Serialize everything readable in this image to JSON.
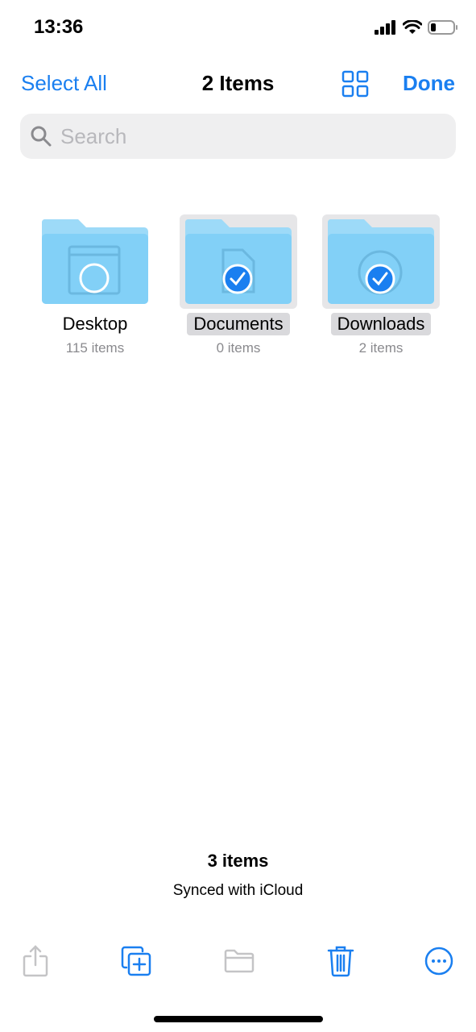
{
  "status_bar": {
    "time": "13:36",
    "icons": [
      "cellular-signal-icon",
      "wifi-icon",
      "battery-icon"
    ]
  },
  "nav": {
    "select_all": "Select All",
    "title": "2 Items",
    "view_toggle_icon": "grid-view-icon",
    "done": "Done"
  },
  "search": {
    "placeholder": "Search",
    "value": ""
  },
  "items": [
    {
      "name": "Desktop",
      "count": "115 items",
      "selected": false,
      "icon": "desktop-folder-icon"
    },
    {
      "name": "Documents",
      "count": "0 items",
      "selected": true,
      "icon": "documents-folder-icon"
    },
    {
      "name": "Downloads",
      "count": "2 items",
      "selected": true,
      "icon": "downloads-folder-icon"
    }
  ],
  "footer": {
    "count": "3 items",
    "sync_status": "Synced with iCloud"
  },
  "toolbar": {
    "buttons": [
      {
        "icon": "share-icon",
        "enabled": false
      },
      {
        "icon": "duplicate-icon",
        "enabled": true
      },
      {
        "icon": "move-folder-icon",
        "enabled": false
      },
      {
        "icon": "trash-icon",
        "enabled": true
      },
      {
        "icon": "more-icon",
        "enabled": true
      }
    ]
  },
  "colors": {
    "accent": "#1a7ff0",
    "disabled": "#c4c4c6",
    "folder": "#82d0f7"
  }
}
